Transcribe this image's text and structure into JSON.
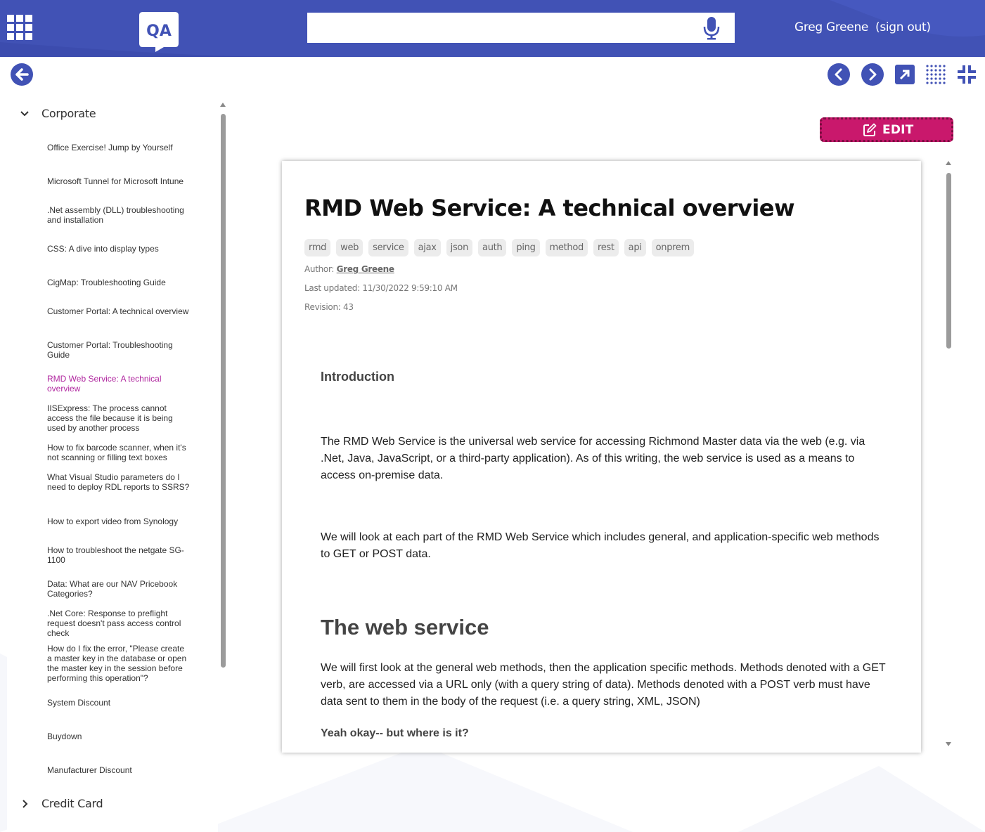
{
  "header": {
    "logo_text": "QA",
    "search": {
      "value": "",
      "placeholder": ""
    },
    "user_name": "Greg Greene",
    "sign_out_label": "(sign out)"
  },
  "toolbar": {
    "icons": [
      "back-icon",
      "previous-icon",
      "next-icon",
      "open-external-icon",
      "grid-dots-icon",
      "collapse-icon"
    ]
  },
  "sidebar": {
    "categories": [
      {
        "label": "Corporate",
        "expanded": true,
        "items": [
          {
            "label": "Office Exercise!      Jump by Yourself"
          },
          {
            "label": "Microsoft Tunnel for Microsoft Intune"
          },
          {
            "label": ".Net assembly (DLL) troubleshooting and installation"
          },
          {
            "label": "CSS: A dive into display types"
          },
          {
            "label": "CigMap: Troubleshooting Guide"
          },
          {
            "label": "Customer Portal:  A technical overview"
          },
          {
            "label": "Customer Portal:  Troubleshooting Guide"
          },
          {
            "label": "RMD Web Service: A technical overview",
            "active": true
          },
          {
            "label": "IISExpress: The process cannot access the file because it is being used by another process"
          },
          {
            "label": "How to fix barcode scanner, when it's not scanning or filling text boxes"
          },
          {
            "label": "What Visual Studio parameters do I need to deploy RDL reports to SSRS?"
          },
          {
            "label": "How to export video from Synology"
          },
          {
            "label": "How to troubleshoot the netgate SG-1100"
          },
          {
            "label": "Data: What are our NAV Pricebook Categories?"
          },
          {
            "label": ".Net Core: Response to preflight request doesn't pass access control check"
          },
          {
            "label": "How do I fix the error, \"Please create a master key in the database or open the master key in the session before performing this operation\"?"
          },
          {
            "label": "System Discount"
          },
          {
            "label": "Buydown"
          },
          {
            "label": "Manufacturer Discount"
          }
        ]
      },
      {
        "label": "Credit Card",
        "expanded": false
      }
    ]
  },
  "edit_button": {
    "label": "EDIT",
    "color": "#c9186c"
  },
  "article": {
    "title": "RMD Web Service: A technical overview",
    "tags": [
      "rmd",
      "web",
      "service",
      "ajax",
      "json",
      "auth",
      "ping",
      "method",
      "rest",
      "api",
      "onprem"
    ],
    "author_label": "Author: ",
    "author_name": "Greg Greene",
    "last_updated": "Last updated: 11/30/2022 9:59:10 AM",
    "revision": "Revision: 43",
    "intro_heading": "Introduction",
    "intro_p1": "The RMD Web Service is the universal web service for accessing Richmond Master data via the web (e.g. via .Net, Java, JavaScript, or a third-party application). As of this writing, the web service is used as a means to access on-premise data.",
    "intro_p2": "We will look at each part of the RMD Web Service which includes general, and application-specific web methods to GET or POST data.",
    "web_heading": "The web service",
    "web_p1": "We will first look at the general web methods, then the application specific methods. Methods denoted with a GET verb, are accessed via a URL only (with a query string of data). Methods denoted with a POST verb must have data sent to them in the body of the request (i.e. a query string, XML, JSON)",
    "yeah_heading": "Yeah okay-- but where is it?"
  },
  "colors": {
    "header_bg": "#4152b5",
    "active_link": "#b0269f",
    "accent": "#c9186c"
  }
}
